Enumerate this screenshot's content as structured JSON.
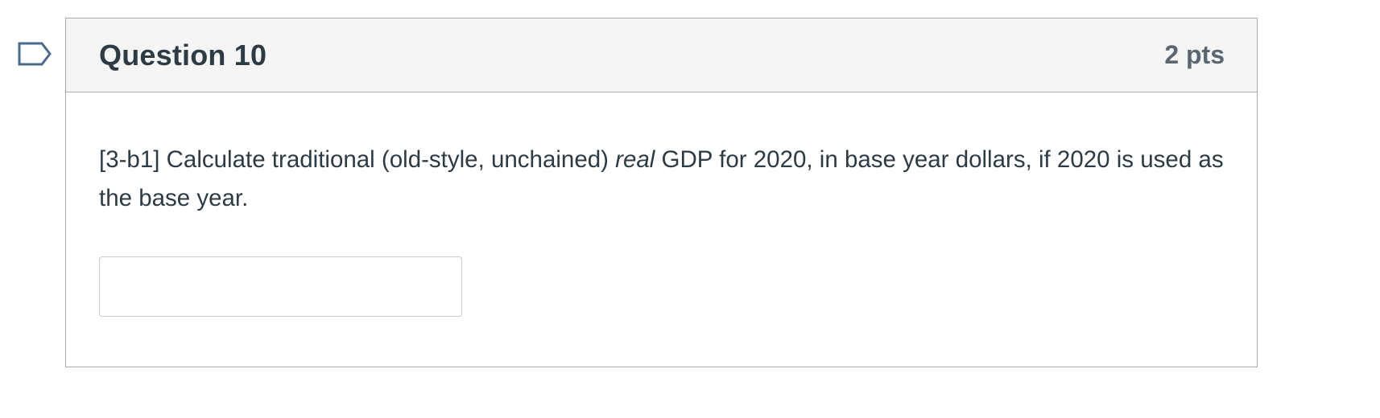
{
  "question": {
    "title": "Question 10",
    "points": "2 pts",
    "flag_icon": "bookmark-flag-icon",
    "text_before": "[3-b1] Calculate traditional (old-style, unchained) ",
    "text_emphasis": "real",
    "text_after": " GDP for 2020, in base year dollars, if 2020 is used as the base year.",
    "answer_value": "",
    "answer_placeholder": ""
  },
  "colors": {
    "header_bg": "#f5f5f5",
    "border": "#aaaaaa",
    "text": "#2d3b45",
    "points_text": "#5a6670",
    "flag_stroke": "#4a6a8e"
  }
}
